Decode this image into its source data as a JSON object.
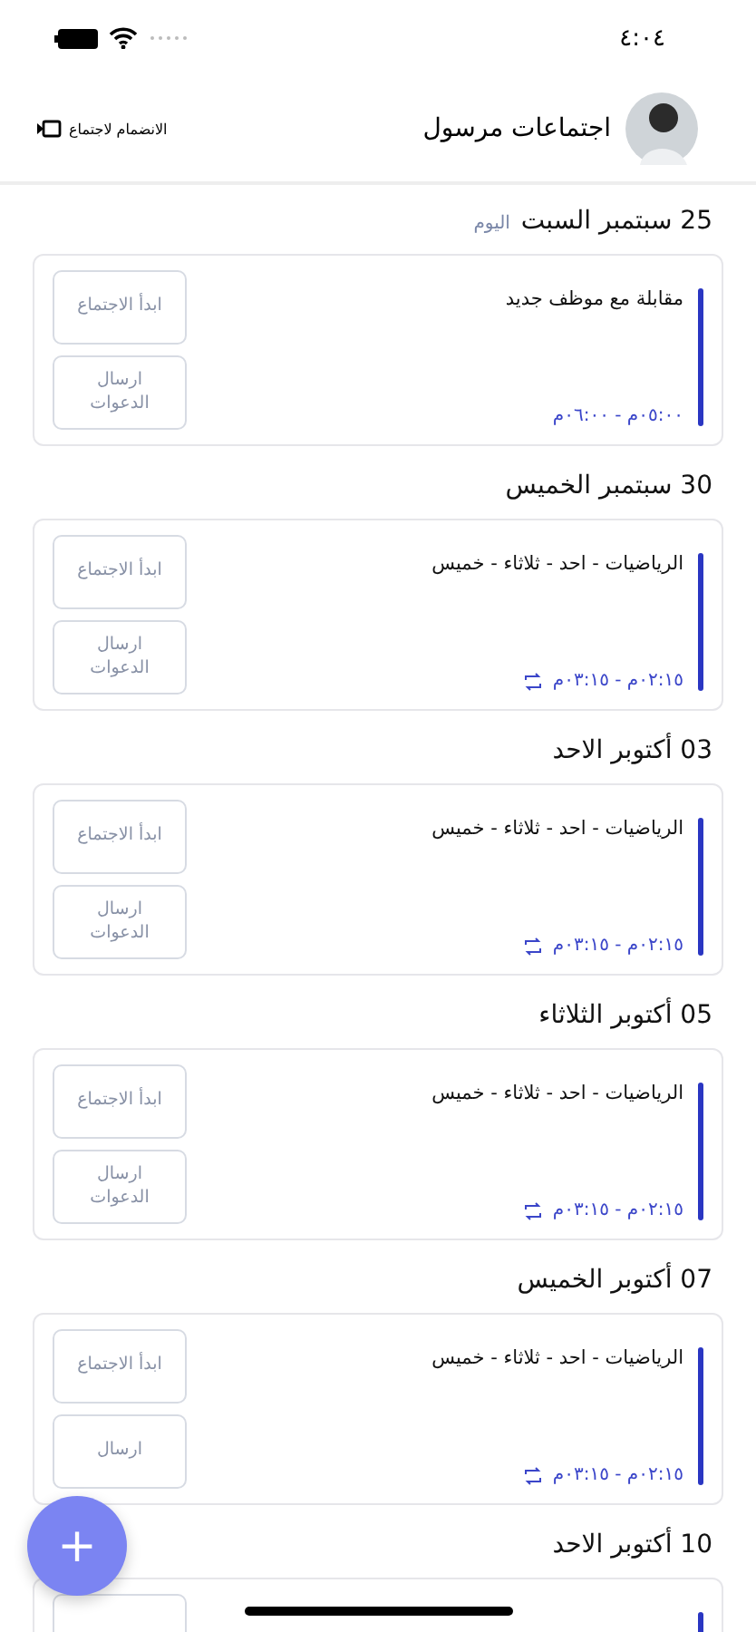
{
  "status_bar": {
    "time": "٤:٠٤"
  },
  "header": {
    "title": "اجتماعات مرسول",
    "join_label": "الانضمام لاجتماع"
  },
  "days": [
    {
      "date": "25 سبتمبر السبت",
      "today_badge": "اليوم",
      "meetings": [
        {
          "title": "مقابلة مع موظف جديد",
          "time": "٠٥:٠٠م - ٠٦:٠٠م",
          "repeat": false,
          "start_label": "ابدأ الاجتماع",
          "invite_label": "ارسال الدعوات"
        }
      ]
    },
    {
      "date": "30 سبتمبر الخميس",
      "meetings": [
        {
          "title": "الرياضيات - احد - ثلاثاء - خميس",
          "time": "٠٢:١٥م - ٠٣:١٥م",
          "repeat": true,
          "start_label": "ابدأ الاجتماع",
          "invite_label": "ارسال الدعوات"
        }
      ]
    },
    {
      "date": "03 أكتوبر الاحد",
      "meetings": [
        {
          "title": "الرياضيات - احد - ثلاثاء - خميس",
          "time": "٠٢:١٥م - ٠٣:١٥م",
          "repeat": true,
          "start_label": "ابدأ الاجتماع",
          "invite_label": "ارسال الدعوات"
        }
      ]
    },
    {
      "date": "05 أكتوبر الثلاثاء",
      "meetings": [
        {
          "title": "الرياضيات - احد - ثلاثاء - خميس",
          "time": "٠٢:١٥م - ٠٣:١٥م",
          "repeat": true,
          "start_label": "ابدأ الاجتماع",
          "invite_label": "ارسال الدعوات"
        }
      ]
    },
    {
      "date": "07 أكتوبر الخميس",
      "meetings": [
        {
          "title": "الرياضيات - احد - ثلاثاء - خميس",
          "time": "٠٢:١٥م - ٠٣:١٥م",
          "repeat": true,
          "start_label": "ابدأ الاجتماع",
          "invite_label": "ارسال"
        }
      ]
    },
    {
      "date": "10 أكتوبر الاحد",
      "meetings": [
        {
          "partial": true
        }
      ]
    }
  ],
  "fab": {
    "symbol": "+"
  }
}
